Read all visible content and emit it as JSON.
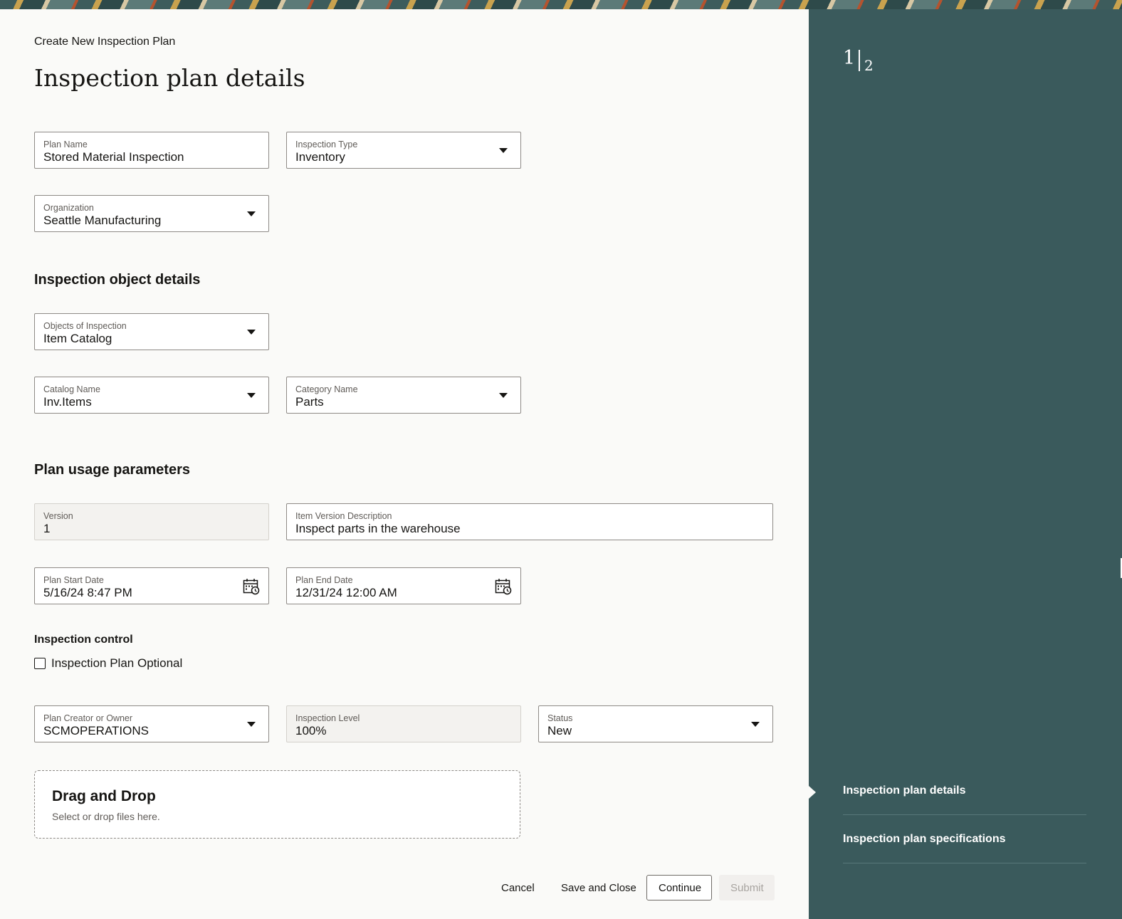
{
  "header": {
    "breadcrumb": "Create New Inspection Plan",
    "page_title": "Inspection plan details"
  },
  "plan_details": {
    "plan_name": {
      "label": "Plan Name",
      "value": "Stored Material Inspection"
    },
    "inspection_type": {
      "label": "Inspection Type",
      "value": "Inventory"
    },
    "organization": {
      "label": "Organization",
      "value": "Seattle Manufacturing"
    }
  },
  "object_details": {
    "title": "Inspection object details",
    "objects_of_inspection": {
      "label": "Objects of Inspection",
      "value": "Item Catalog"
    },
    "catalog_name": {
      "label": "Catalog Name",
      "value": "Inv.Items"
    },
    "category_name": {
      "label": "Category Name",
      "value": "Parts"
    }
  },
  "usage_parameters": {
    "title": "Plan usage parameters",
    "version": {
      "label": "Version",
      "value": "1"
    },
    "item_version_description": {
      "label": "Item Version Description",
      "value": "Inspect parts in the warehouse"
    },
    "plan_start_date": {
      "label": "Plan Start Date",
      "value": "5/16/24 8:47 PM"
    },
    "plan_end_date": {
      "label": "Plan End Date",
      "value": "12/31/24 12:00 AM"
    }
  },
  "inspection_control": {
    "title": "Inspection control",
    "optional_checkbox": {
      "label": "Inspection Plan Optional",
      "checked": false
    },
    "plan_creator": {
      "label": "Plan Creator or Owner",
      "value": "SCMOPERATIONS"
    },
    "inspection_level": {
      "label": "Inspection Level",
      "value": "100%"
    },
    "status": {
      "label": "Status",
      "value": "New"
    }
  },
  "dropzone": {
    "title": "Drag and Drop",
    "subtitle": "Select or drop files here."
  },
  "footer": {
    "cancel": "Cancel",
    "save_and_close": "Save and Close",
    "continue": "Continue",
    "submit": "Submit"
  },
  "sidebar": {
    "step_current": "1",
    "step_total": "2",
    "steps": [
      {
        "label": "Inspection plan details",
        "active": true
      },
      {
        "label": "Inspection plan specifications",
        "active": false
      }
    ]
  },
  "colors": {
    "sidebar_bg": "#3a5a5c",
    "page_bg": "#fafaf8",
    "field_border": "#8e8a86"
  },
  "icons": {
    "dropdown": "chevron-down-icon",
    "date_picker": "calendar-clock-icon"
  }
}
